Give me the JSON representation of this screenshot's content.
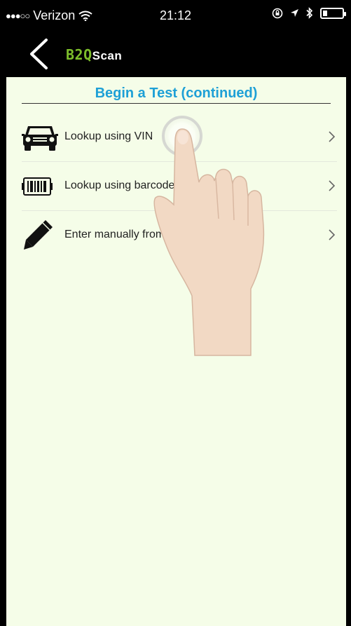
{
  "status": {
    "signal": "●●●○○",
    "carrier": "Verizon",
    "time": "21:12"
  },
  "nav": {
    "logo_prefix": "B2Q",
    "logo_suffix": "Scan"
  },
  "page": {
    "title": "Begin a Test (continued)"
  },
  "options": [
    {
      "label": "Lookup using VIN",
      "icon": "car-icon"
    },
    {
      "label": "Lookup using barcode",
      "icon": "barcode-icon"
    },
    {
      "label": "Enter manually from battery label",
      "icon": "pencil-icon"
    }
  ],
  "colors": {
    "accent": "#1ea0d6",
    "brand_green": "#7dbe2b",
    "background": "#f5fde8"
  }
}
